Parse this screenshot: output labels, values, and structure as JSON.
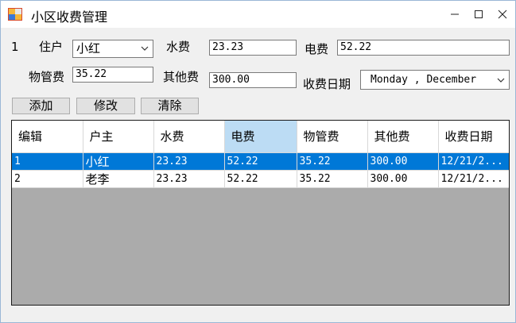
{
  "window": {
    "title": "小区收费管理",
    "minimize_icon": "minimize-icon",
    "maximize_icon": "maximize-icon",
    "close_icon": "close-icon"
  },
  "form": {
    "index": "1",
    "resident_label": "住户",
    "resident_value": "小红",
    "water_label": "水费",
    "water_value": "23.23",
    "electric_label": "电费",
    "electric_value": "52.22",
    "property_label": "物管费",
    "property_value": "35.22",
    "other_label": "其他费",
    "other_value": "300.00",
    "date_label": "收费日期",
    "date_value": "Monday  ,  December"
  },
  "buttons": {
    "add": "添加",
    "edit": "修改",
    "clear": "清除"
  },
  "table": {
    "headers": [
      "编辑",
      "户主",
      "水费",
      "电费",
      "物管费",
      "其他费",
      "收费日期"
    ],
    "rows": [
      [
        "1",
        "小红",
        "23.23",
        "52.22",
        "35.22",
        "300.00",
        "12/21/2..."
      ],
      [
        "2",
        "老李",
        "23.23",
        "52.22",
        "35.22",
        "300.00",
        "12/21/2..."
      ]
    ],
    "selected_row": 0,
    "highlighted_header": 3
  },
  "colors": {
    "selection": "#0078d7",
    "header_highlight": "#bcdcf4",
    "grid_background": "#ababab"
  }
}
